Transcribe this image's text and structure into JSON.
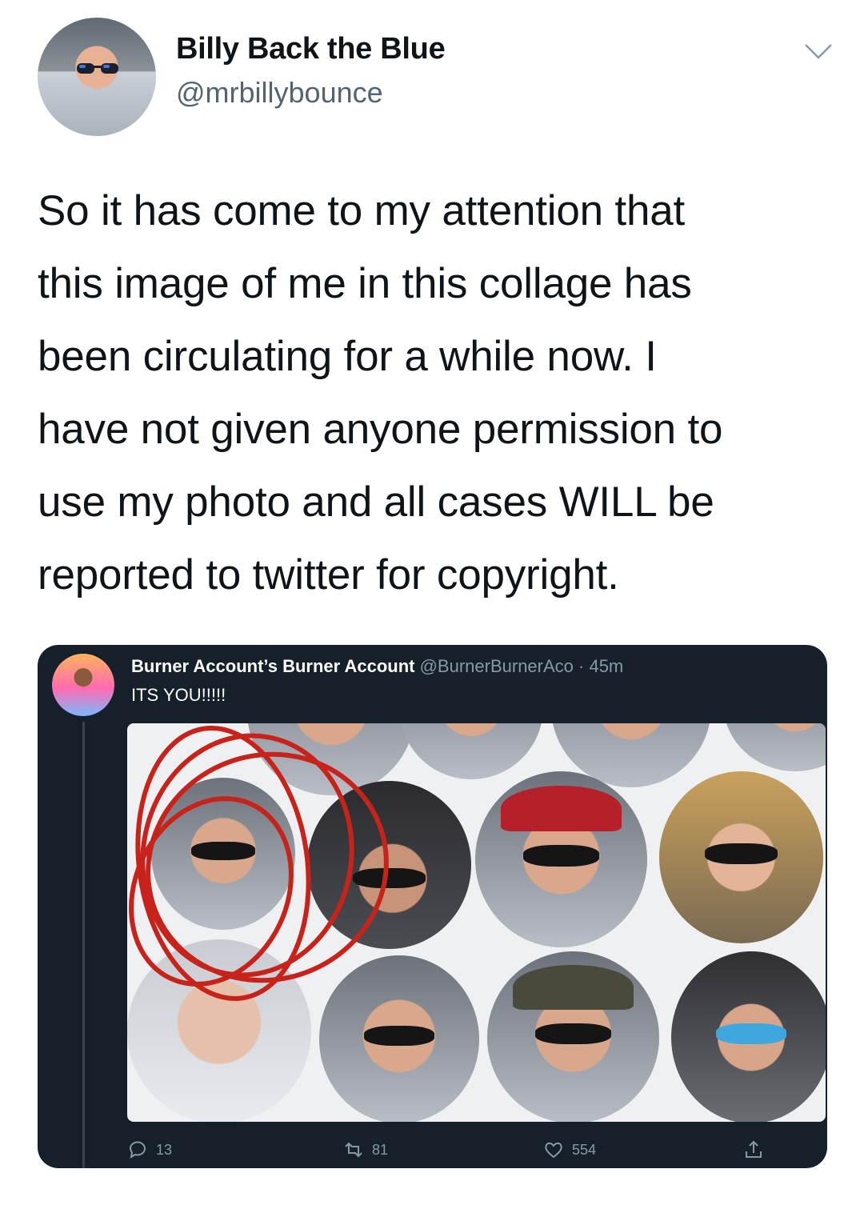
{
  "tweet": {
    "author_name": "Billy Back the Blue",
    "author_handle": "@mrbillybounce",
    "text_lines": [
      "So it has come to my attention that",
      "this image of me in this collage has",
      "been circulating for a while now. I",
      "have not given anyone permission to",
      "use my photo and all cases WILL be",
      "reported to twitter for copyright."
    ],
    "menu_icon": "chevron-down-icon"
  },
  "embedded": {
    "name": "Burner Account’s Burner Account",
    "meta": " @BurnerBurnerAco · 45m",
    "text": "ITS YOU!!!!!",
    "stats": {
      "replies": "13",
      "retweets": "81",
      "likes": "554"
    },
    "icons": [
      "reply-icon",
      "retweet-icon",
      "like-icon",
      "share-icon"
    ],
    "colors": {
      "background": "#15202b",
      "scribble": "#c8231b"
    }
  }
}
